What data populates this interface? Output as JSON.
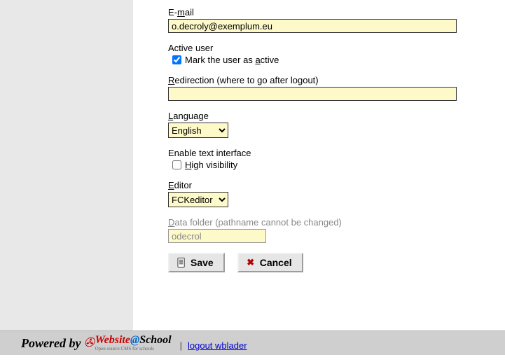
{
  "email": {
    "label_pre": "E-",
    "label_key": "m",
    "label_post": "ail",
    "value": "o.decroly@exemplum.eu"
  },
  "active": {
    "heading": "Active user",
    "checked": true,
    "label_pre": "Mark the user as ",
    "label_key": "a",
    "label_post": "ctive"
  },
  "redir": {
    "label_key": "R",
    "label_post": "edirection (where to go after logout)",
    "value": ""
  },
  "language": {
    "label_key": "L",
    "label_post": "anguage",
    "selected": "English"
  },
  "textif": {
    "heading": "Enable text interface",
    "checked": false,
    "label_key": "H",
    "label_post": "igh visibility"
  },
  "editor": {
    "label_key": "E",
    "label_post": "ditor",
    "selected": "FCKeditor"
  },
  "datafolder": {
    "label_key": "D",
    "label_post": "ata folder (pathname cannot be changed)",
    "value": "odecrol"
  },
  "buttons": {
    "save": "Save",
    "cancel": "Cancel"
  },
  "footer": {
    "powered": "Powered by",
    "logo_part1": "Website",
    "logo_at": "@",
    "logo_part2": "School",
    "sep": "|",
    "logout": "logout wblader"
  }
}
